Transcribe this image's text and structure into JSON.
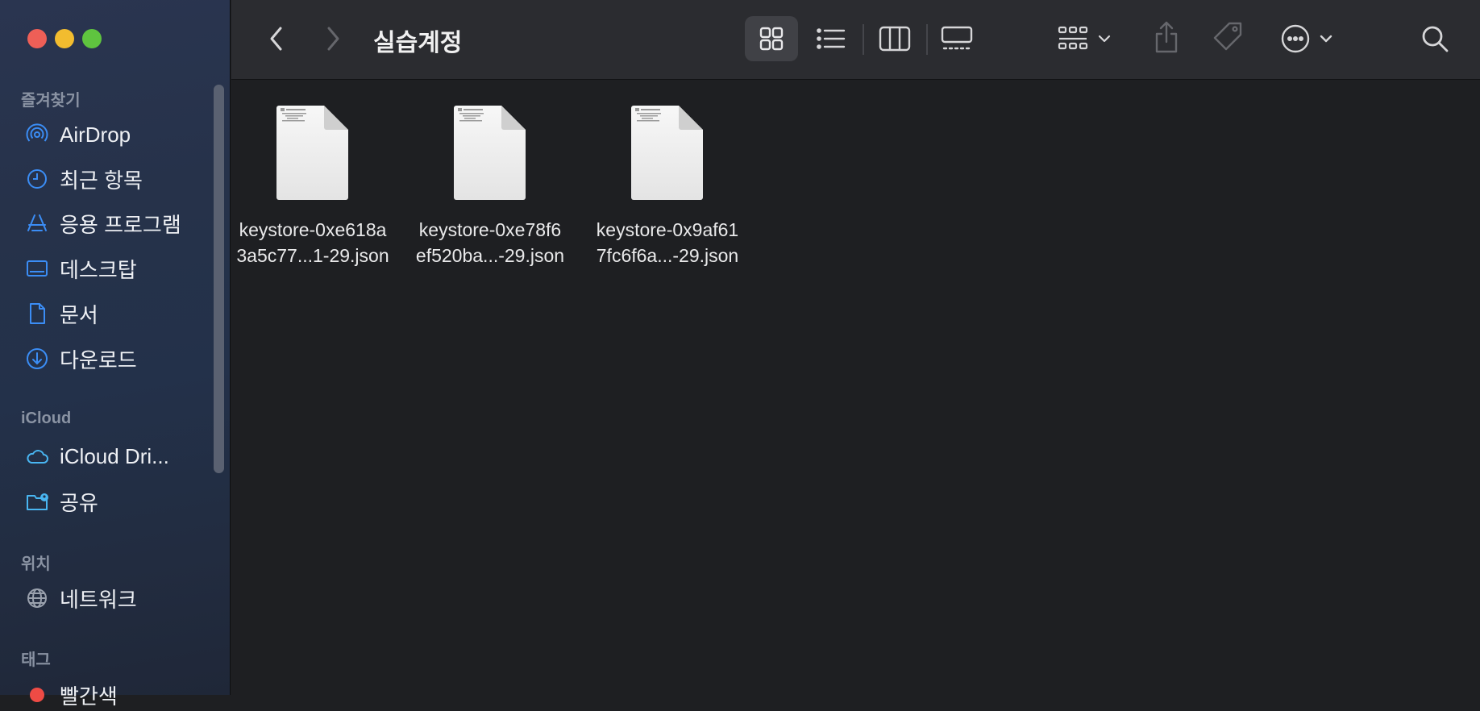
{
  "window": {
    "title": "실습계정"
  },
  "sidebar": {
    "sections": [
      {
        "heading": "즐겨찾기",
        "items": [
          {
            "label": "AirDrop",
            "icon": "airdrop-icon"
          },
          {
            "label": "최근 항목",
            "icon": "clock-icon"
          },
          {
            "label": "응용 프로그램",
            "icon": "applications-icon"
          },
          {
            "label": "데스크탑",
            "icon": "desktop-icon"
          },
          {
            "label": "문서",
            "icon": "document-icon"
          },
          {
            "label": "다운로드",
            "icon": "download-icon"
          }
        ]
      },
      {
        "heading": "iCloud",
        "items": [
          {
            "label": "iCloud Dri...",
            "icon": "icloud-icon"
          },
          {
            "label": "공유",
            "icon": "shared-folder-icon"
          }
        ]
      },
      {
        "heading": "위치",
        "items": [
          {
            "label": "네트워크",
            "icon": "network-globe-icon"
          }
        ]
      },
      {
        "heading": "태그",
        "items": [
          {
            "label": "빨간색",
            "icon": "red-tag-dot-icon"
          }
        ]
      }
    ]
  },
  "colors": {
    "accent": "#3b8df5",
    "tag_red": "#ee4b45"
  },
  "files": [
    {
      "name_line1": "keystore-0xe618a",
      "name_line2": "3a5c77...1-29.json"
    },
    {
      "name_line1": "keystore-0xe78f6",
      "name_line2": "ef520ba...-29.json"
    },
    {
      "name_line1": "keystore-0x9af61",
      "name_line2": "7fc6f6a...-29.json"
    }
  ]
}
